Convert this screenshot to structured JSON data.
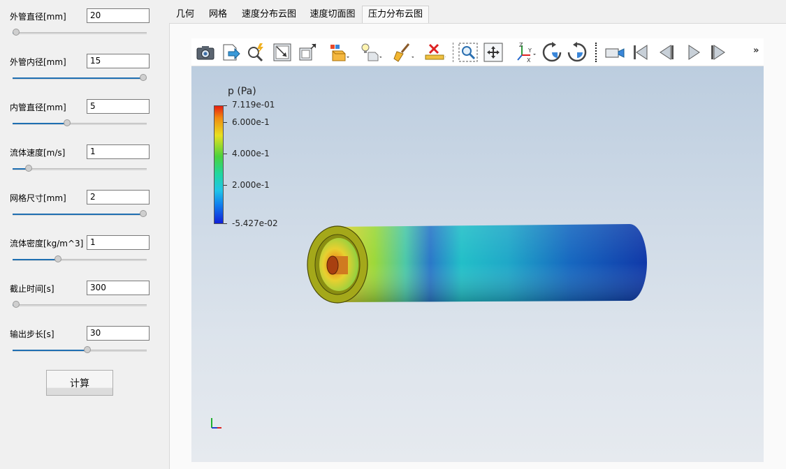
{
  "params": [
    {
      "label": "外管直径[mm]",
      "value": "20",
      "slider": 0.0
    },
    {
      "label": "外管内径[mm]",
      "value": "15",
      "slider": 1.0
    },
    {
      "label": "内管直径[mm]",
      "value": "5",
      "slider": 0.4
    },
    {
      "label": "流体速度[m/s]",
      "value": "1",
      "slider": 0.1
    },
    {
      "label": "网格尺寸[mm]",
      "value": "2",
      "slider": 1.0
    },
    {
      "label": "流体密度[kg/m^3]",
      "value": "1",
      "slider": 0.33
    },
    {
      "label": "截止时间[s]",
      "value": "300",
      "slider": 0.0
    },
    {
      "label": "输出步长[s]",
      "value": "30",
      "slider": 0.56
    }
  ],
  "calc_button": {
    "label": "计算"
  },
  "tabs": [
    {
      "label": "几何",
      "active": false
    },
    {
      "label": "网格",
      "active": false
    },
    {
      "label": "速度分布云图",
      "active": false
    },
    {
      "label": "速度切面图",
      "active": false
    },
    {
      "label": "压力分布云图",
      "active": true
    }
  ],
  "toolbar": {
    "icons": [
      "camera-icon",
      "export-icon",
      "zoom-probe-icon",
      "reset-view-icon",
      "maximize-icon",
      "render-style-icon",
      "lighting-icon",
      "clean-brush-icon",
      "delete-ruler-icon",
      "zoom-box-icon",
      "fit-view-icon",
      "axes-xyz-icon",
      "rotate-cw-icon",
      "rotate-ccw-icon",
      "record-camera-icon",
      "first-frame-icon",
      "prev-frame-icon",
      "play-icon",
      "next-frame-icon"
    ],
    "more": "»"
  },
  "legend": {
    "title": "p (Pa)",
    "labels": [
      "7.119e-01",
      "6.000e-1",
      "4.000e-1",
      "2.000e-1",
      "-5.427e-02"
    ],
    "max": 0.7119,
    "min": -0.05427,
    "ticks": [
      0.6,
      0.4,
      0.2
    ]
  },
  "colors": {
    "accent": "#1f6fb2",
    "tube_end": "#9aa010"
  }
}
